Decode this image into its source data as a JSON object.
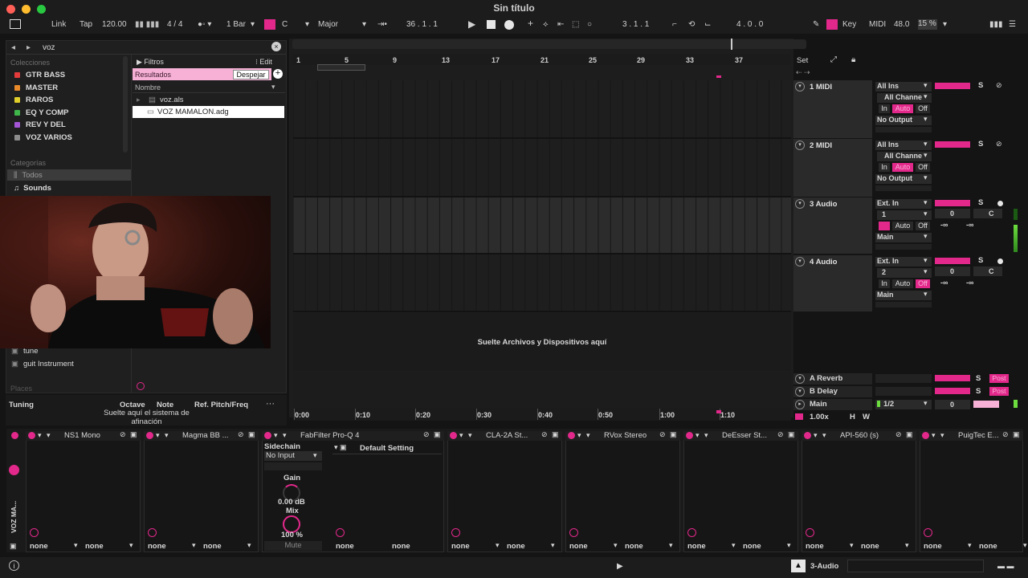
{
  "window": {
    "title": "Sin título"
  },
  "toolbar": {
    "link": "Link",
    "tap": "Tap",
    "tempo": "120.00",
    "signature": "4 / 4",
    "quantize": "1 Bar",
    "key": "C",
    "scale": "Major",
    "position": "36 . 1 . 1",
    "loop_start": "3 . 1 . 1",
    "loop_length": "4 . 0 . 0",
    "key_label": "Key",
    "midi_label": "MIDI",
    "cpu_value": "48.0",
    "cpu_percent": "15 %"
  },
  "browser": {
    "search": "voz",
    "collections_label": "Colecciones",
    "collections": [
      {
        "label": "GTR BASS",
        "color": "#e33b3b"
      },
      {
        "label": "MASTER",
        "color": "#e98a2a"
      },
      {
        "label": "RAROS",
        "color": "#e0cf2a"
      },
      {
        "label": "EQ Y COMP",
        "color": "#3fb64a"
      },
      {
        "label": "REV Y DEL",
        "color": "#a355d6"
      },
      {
        "label": "VOZ VARIOS",
        "color": "#8d8d8d"
      }
    ],
    "categories_label": "Categorías",
    "categories": [
      "Todos",
      "Sounds"
    ],
    "lower_items": [
      "tune",
      "guit Instrument"
    ],
    "places_label": "Places",
    "filters": "Filtros",
    "edit": "Edit",
    "results": "Resultados",
    "clear": "Despejar",
    "name_header": "Nombre",
    "files": [
      "voz.als",
      "VOZ MAMALON.adg"
    ],
    "tuning": {
      "label": "Tuning",
      "octave": "Octave",
      "note": "Note",
      "ref": "Ref. Pitch/Freq",
      "drop_hint": "Suelte aquí el sistema de afinación"
    }
  },
  "arrangement": {
    "bars": [
      "1",
      "5",
      "9",
      "13",
      "17",
      "21",
      "25",
      "29",
      "33",
      "37"
    ],
    "set_label": "Set",
    "drop_hint": "Suelte Archivos y Dispositivos aquí",
    "time_marks": [
      "0:00",
      "0:10",
      "0:20",
      "0:30",
      "0:40",
      "0:50",
      "1:00",
      "1:10"
    ],
    "zoom": "1.00x",
    "h": "H",
    "w": "W"
  },
  "tracks": [
    {
      "name": "1 MIDI",
      "input": "All Ins",
      "channel": "All Channe",
      "monitor": [
        "In",
        "Auto",
        "Off"
      ],
      "output": "No Output"
    },
    {
      "name": "2 MIDI",
      "input": "All Ins",
      "channel": "All Channe",
      "monitor": [
        "In",
        "Auto",
        "Off"
      ],
      "output": "No Output"
    },
    {
      "name": "3 Audio",
      "input": "Ext. In",
      "channel": "1",
      "monitor": [
        "In",
        "Auto",
        "Off"
      ],
      "output": "Main",
      "vol": "0",
      "pan": "C",
      "peak": [
        "-∞",
        "-∞"
      ]
    },
    {
      "name": "4 Audio",
      "input": "Ext. In",
      "channel": "2",
      "monitor": [
        "In",
        "Auto",
        "Off"
      ],
      "output": "Main",
      "vol": "0",
      "pan": "C",
      "peak": [
        "-∞",
        "-∞"
      ]
    }
  ],
  "returns": [
    {
      "name": "A Reverb",
      "s": "S",
      "post": "Post"
    },
    {
      "name": "B Delay",
      "s": "S",
      "post": "Post"
    },
    {
      "name": "Main",
      "ratio": "1/2",
      "vol": "0"
    }
  ],
  "devices": {
    "rack_name": "VOZ MA...",
    "chain": [
      {
        "name": "NS1 Mono"
      },
      {
        "name": "Magma BB ..."
      },
      {
        "name": "FabFilter Pro-Q 4"
      },
      {
        "name": "CLA-2A St..."
      },
      {
        "name": "RVox Stereo"
      },
      {
        "name": "DeEsser St..."
      },
      {
        "name": "API-560 (s)"
      },
      {
        "name": "PuigTec E..."
      }
    ],
    "sidechain_label": "Sidechain",
    "sidechain_value": "No Input",
    "gain_label": "Gain",
    "gain_value": "0.00 dB",
    "mix_label": "Mix",
    "mix_value": "100 %",
    "mute_label": "Mute",
    "preset": "Default Setting",
    "none": "none"
  },
  "status": {
    "track": "3-Audio"
  }
}
